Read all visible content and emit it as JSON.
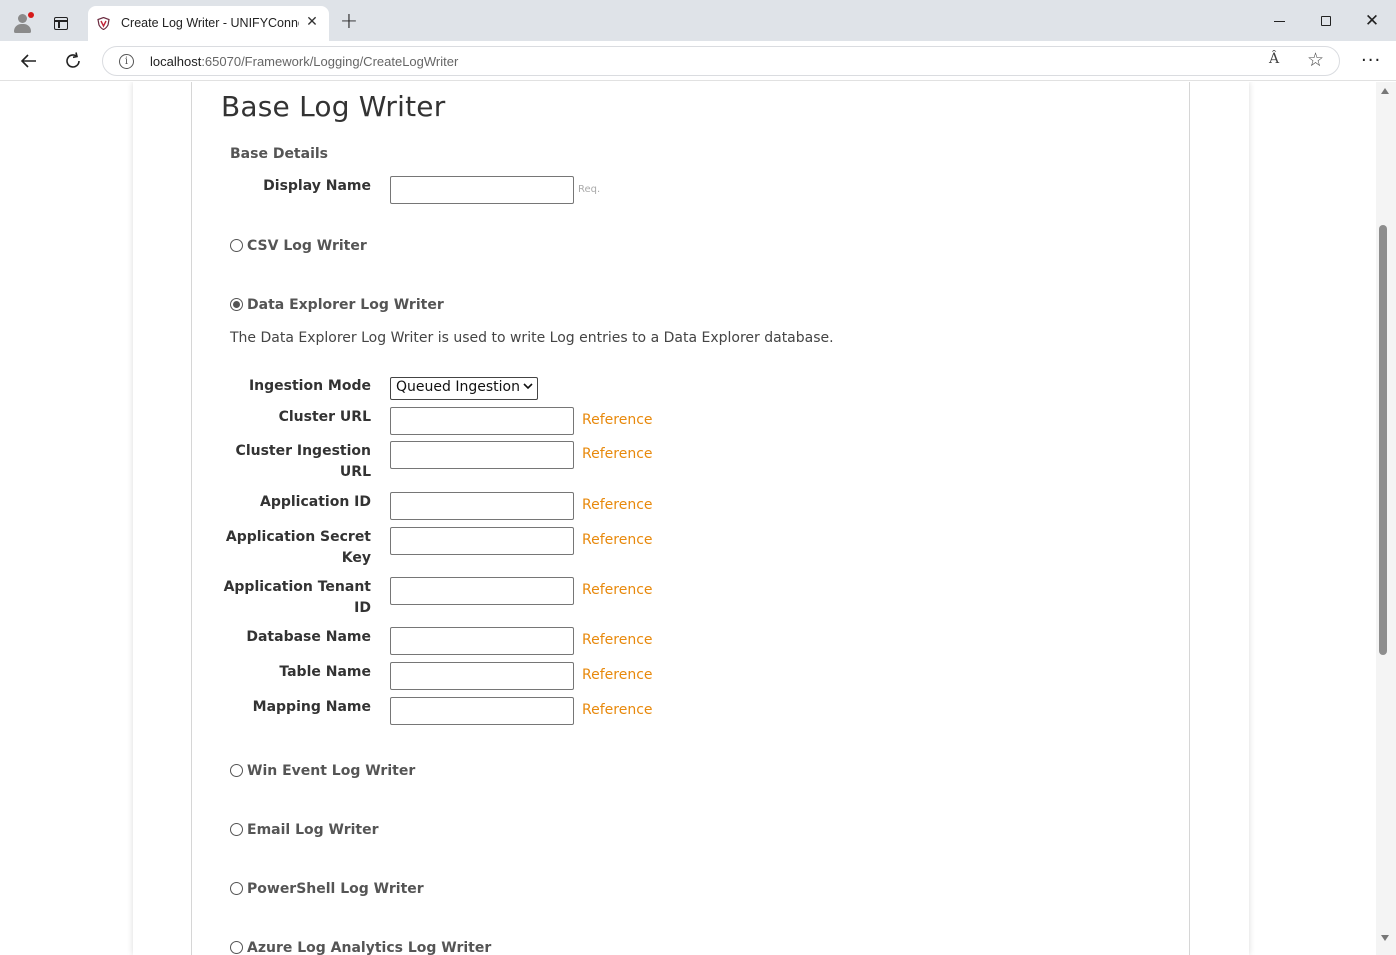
{
  "browser": {
    "tab_title": "Create Log Writer - UNIFYConnect",
    "url_host": "localhost",
    "url_rest": ":65070/Framework/Logging/CreateLogWriter",
    "read_aloud_glyph": "Â",
    "icons": [
      "profile-icon",
      "tab-actions-icon",
      "close-icon",
      "new-tab-icon",
      "back-icon",
      "reload-icon",
      "site-info-icon",
      "read-aloud-icon",
      "favorite-icon",
      "more-icon",
      "minimize-icon",
      "maximize-icon",
      "window-close-icon"
    ]
  },
  "page": {
    "title": "Base Log Writer",
    "section": "Base Details",
    "display_name_label": "Display Name",
    "display_name_value": "",
    "req_hint": "Req.",
    "writers": [
      {
        "label": "CSV Log Writer",
        "selected": false
      },
      {
        "label": "Data Explorer Log Writer",
        "selected": true
      },
      {
        "label": "Win Event Log Writer",
        "selected": false
      },
      {
        "label": "Email Log Writer",
        "selected": false
      },
      {
        "label": "PowerShell Log Writer",
        "selected": false
      },
      {
        "label": "Azure Log Analytics Log Writer",
        "selected": false
      }
    ],
    "description": "The Data Explorer Log Writer is used to write Log entries to a Data Explorer database.",
    "ingestion_mode_label": "Ingestion Mode",
    "ingestion_mode_value": "Queued Ingestion",
    "reference_label": "Reference",
    "fields": [
      {
        "label": "Cluster URL",
        "value": ""
      },
      {
        "label": "Cluster Ingestion URL",
        "value": ""
      },
      {
        "label": "Application ID",
        "value": ""
      },
      {
        "label": "Application Secret Key",
        "value": ""
      },
      {
        "label": "Application Tenant ID",
        "value": ""
      },
      {
        "label": "Database Name",
        "value": ""
      },
      {
        "label": "Table Name",
        "value": ""
      },
      {
        "label": "Mapping Name",
        "value": ""
      }
    ]
  },
  "colors": {
    "reference_link": "#e8890c",
    "chrome_bg": "#dfe3e8"
  }
}
